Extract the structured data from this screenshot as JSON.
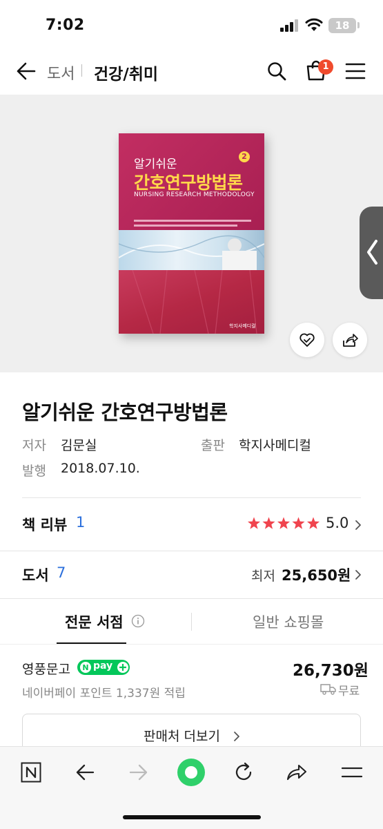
{
  "status_bar": {
    "time": "7:02",
    "battery": "18"
  },
  "header": {
    "breadcrumb": [
      "도서",
      "건강/취미"
    ],
    "cart_count": "1"
  },
  "book_cover": {
    "subtitle": "알기쉬운",
    "title": "간호연구방법론",
    "english_title": "NURSING RESEARCH METHODOLOGY",
    "edition": "2"
  },
  "product": {
    "title": "알기쉬운 간호연구방법론",
    "author_label": "저자",
    "author": "김문실",
    "publisher_label": "출판",
    "publisher": "학지사메디컬",
    "date_label": "발행",
    "date": "2018.07.10."
  },
  "review": {
    "label": "책 리뷰",
    "count": "1",
    "rating": "5.0",
    "stars": 5
  },
  "books": {
    "label": "도서",
    "count": "7",
    "lowest_label": "최저",
    "lowest_price": "25,650원"
  },
  "tabs": {
    "active": "전문 서점",
    "inactive": "일반 쇼핑몰"
  },
  "offer": {
    "store": "영풍문고",
    "npay": "pay",
    "price": "26,730원",
    "points": "네이버페이 포인트 1,337원 적립",
    "shipping": "무료"
  },
  "more_button": "판매처 더보기",
  "colors": {
    "accent_blue": "#2b6fdc",
    "star_red": "#f0444e",
    "badge": "#f04b2d",
    "npay_green": "#03c75a"
  }
}
